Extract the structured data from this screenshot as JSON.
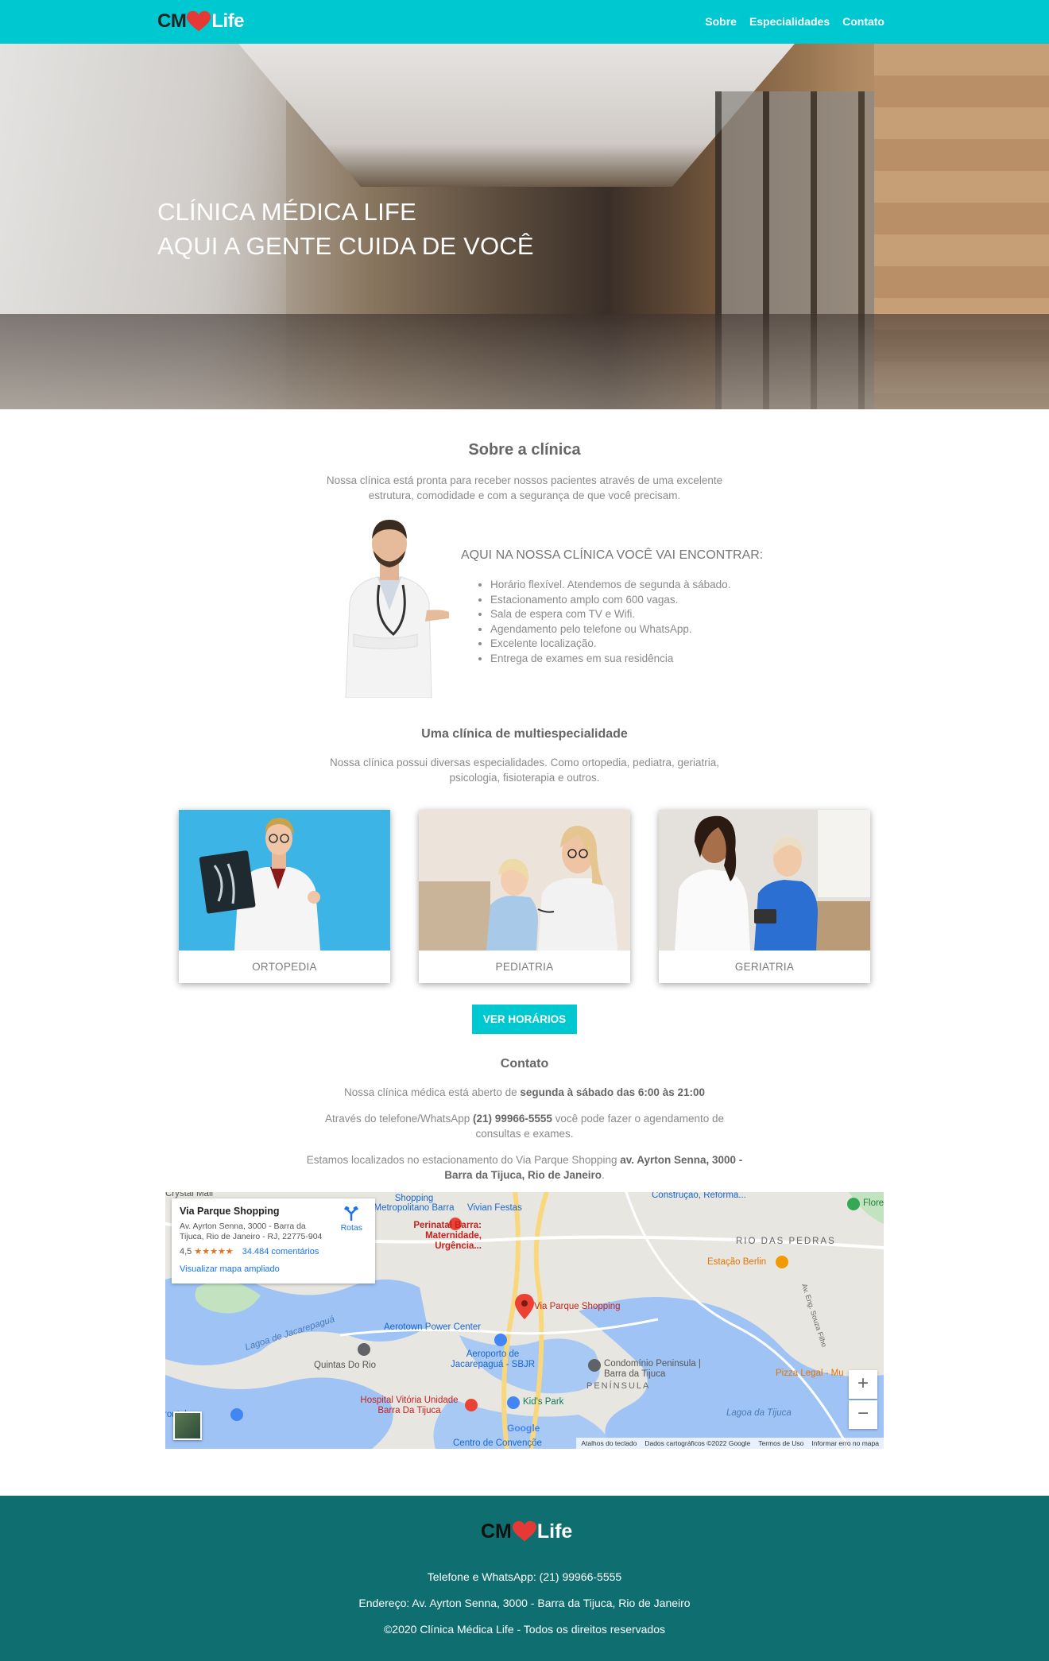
{
  "brand": {
    "cm": "CM",
    "life": "Life",
    "heart_color": "#e53935"
  },
  "nav": {
    "links": [
      "Sobre",
      "Especialidades",
      "Contato"
    ],
    "bg": "#00c8d0"
  },
  "hero": {
    "line1": "CLÍNICA MÉDICA LIFE",
    "line2": "AQUI A GENTE CUIDA DE VOCÊ"
  },
  "about": {
    "title": "Sobre a clínica",
    "text": "Nossa clínica está pronta para receber nossos pacientes através de uma excelente estrutura, comodidade e com a segurança de que você precisam.",
    "features_title": "AQUI NA NOSSA CLÍNICA VOCÊ VAI ENCONTRAR:",
    "features": [
      "Horário flexível. Atendemos de segunda à sábado.",
      "Estacionamento amplo com 600 vagas.",
      "Sala de espera com TV e Wifi.",
      "Agendamento pelo telefone ou WhatsApp.",
      "Excelente localização.",
      "Entrega de exames em sua residência"
    ]
  },
  "specialties": {
    "title": "Uma clínica de multiespecialidade",
    "text": "Nossa clínica possui diversas especialidades. Como ortopedia, pediatra, geriatria, psicologia, fisioterapia e outros.",
    "cards": [
      "ORTOPEDIA",
      "PEDIATRIA",
      "GERIATRIA"
    ],
    "button": "VER HORÁRIOS"
  },
  "contact": {
    "title": "Contato",
    "hours_prefix": "Nossa clínica médica está aberto de ",
    "hours_bold": "segunda à sábado das 6:00 às 21:00",
    "phone_prefix": "Através do telefone/WhatsApp ",
    "phone_bold": "(21) 99966-5555",
    "phone_suffix": " você pode fazer o agendamento de consultas e exames.",
    "loc_prefix": "Estamos localizados no estacionamento do Via Parque Shopping ",
    "loc_bold": "av. Ayrton Senna, 3000 - Barra da Tijuca, Rio de Janeiro",
    "loc_suffix": "."
  },
  "map": {
    "place": "Via Parque Shopping",
    "address": "Av. Ayrton Senna, 3000 - Barra da Tijuca, Rio de Janeiro - RJ, 22775-904",
    "rating": "4,5",
    "stars": "★★★★★",
    "reviews": "34.484 comentários",
    "larger_map": "Visualizar mapa ampliado",
    "routes": "Rotas",
    "labels": {
      "pin": "Via Parque Shopping",
      "aerotown": "Aerotown Power Center",
      "aeroporto": "Aeroporto de Jacarepaguá - SBJR",
      "quintas": "Quintas Do Rio",
      "lagoa_jac": "Lagoa de Jacarepaguá",
      "condominio": "Condomínio Peninsula | Barra da Tijuca",
      "peninsula": "PENÍNSULA",
      "kids": "Kid's Park",
      "hospital": "Hospital Vitória Unidade Barra Da Tijuca",
      "perinatal": "Perinatal Barra: Maternidade, Urgência...",
      "vivian": "Vivian Festas",
      "shopping": "Shopping Metropolitano Barra",
      "rio_pedras": "RIO DAS PEDRAS",
      "estacao": "Estação Berlin",
      "pizza": "Pizza Legal - Mu",
      "lagoa_tij": "Lagoa da Tijuca",
      "construcao": "Construção, Reforma...",
      "flore": "Flore",
      "centro": "Centro de Convençõe",
      "crystal": "Crystal Mall",
      "rontal": "rontal",
      "eng": "Av. Eng. Souza Filho",
      "google": "Google"
    },
    "zoom_in": "+",
    "zoom_out": "−",
    "attribution": [
      "Atalhos do teclado",
      "Dados cartográficos ©2022 Google",
      "Termos de Uso",
      "Informar erro no mapa"
    ]
  },
  "footer": {
    "phone": "Telefone e WhatsApp: (21) 99966-5555",
    "address": "Endereço: Av. Ayrton Senna, 3000 - Barra da Tijuca, Rio de Janeiro",
    "copyright": "©2020 Clínica Médica Life - Todos os direitos reservados",
    "bg": "#0f6e70"
  }
}
